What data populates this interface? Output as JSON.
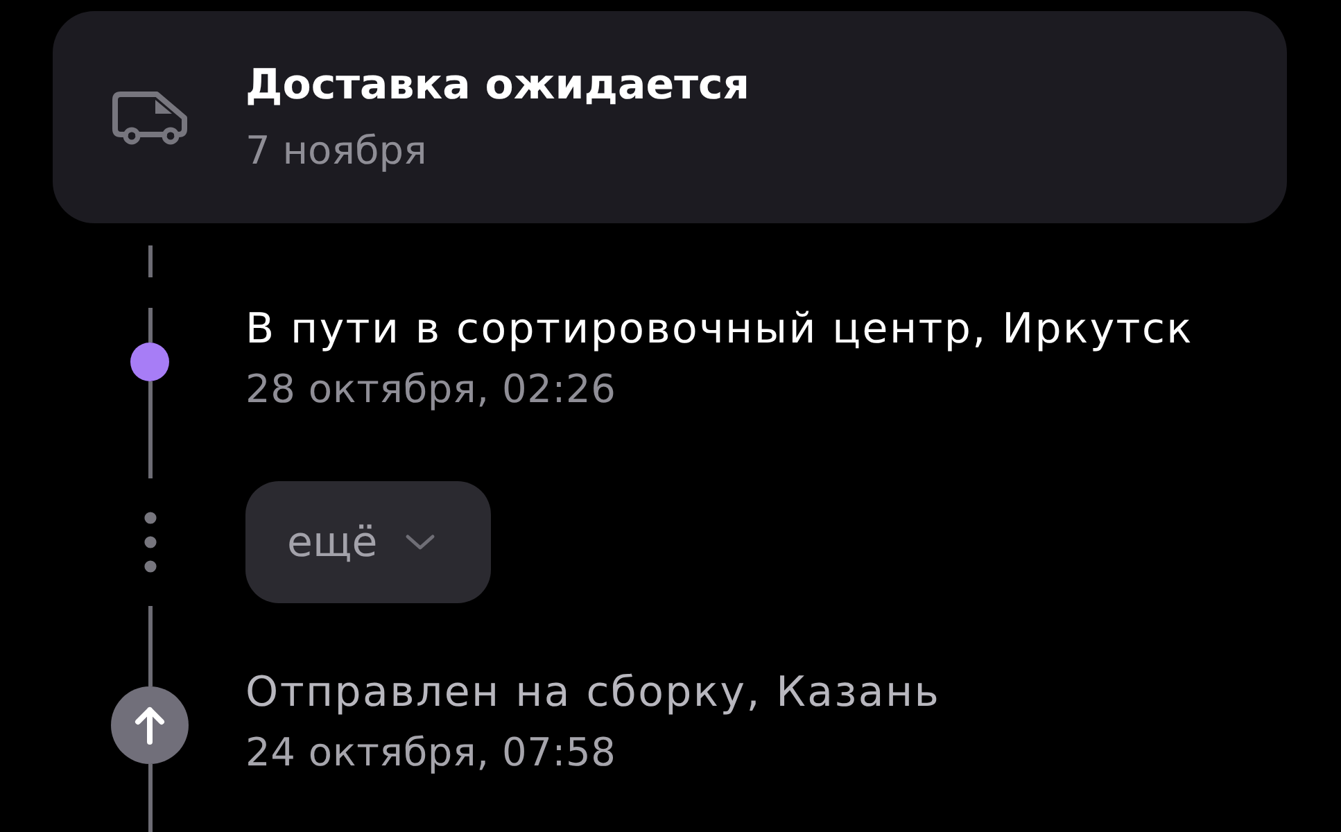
{
  "delivery_card": {
    "title": "Доставка ожидается",
    "date": "7 ноября"
  },
  "timeline": [
    {
      "kind": "dot",
      "current": true,
      "title": "В пути в сортировочный центр, Иркутск",
      "date": "28 октября, 02:26"
    },
    {
      "kind": "more",
      "label": "ещё"
    },
    {
      "kind": "arrow",
      "current": false,
      "title": "Отправлен на сборку, Казань",
      "date": "24 октября, 07:58"
    }
  ]
}
